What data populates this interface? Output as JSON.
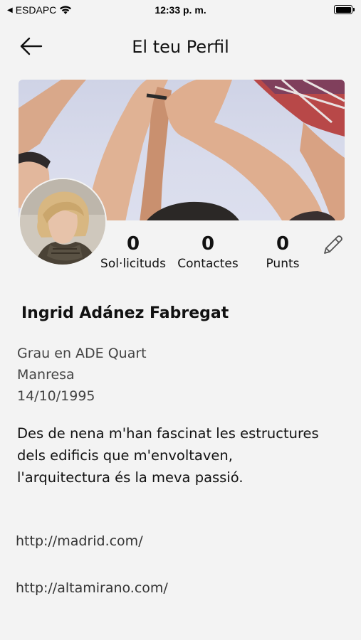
{
  "status_bar": {
    "carrier": "ESDAPC",
    "time": "12:33 p. m."
  },
  "header": {
    "title": "El teu Perfil"
  },
  "stats": [
    {
      "value": "0",
      "label": "Sol·licituds"
    },
    {
      "value": "0",
      "label": "Contactes"
    },
    {
      "value": "0",
      "label": "Punts"
    }
  ],
  "profile": {
    "name": "Ingrid Adánez Fabregat",
    "degree": "Grau en ADE Quart",
    "city": "Manresa",
    "birthdate": "14/10/1995",
    "bio": "Des de nena m'han fascinat les estructures dels edificis que m'envoltaven, l'arquitectura és la meva passió.",
    "links": [
      "http://madrid.com/",
      "http://altamirano.com/"
    ]
  },
  "colors": {
    "background": "#f3f3f3",
    "text": "#111111",
    "secondary_text": "#444444"
  }
}
